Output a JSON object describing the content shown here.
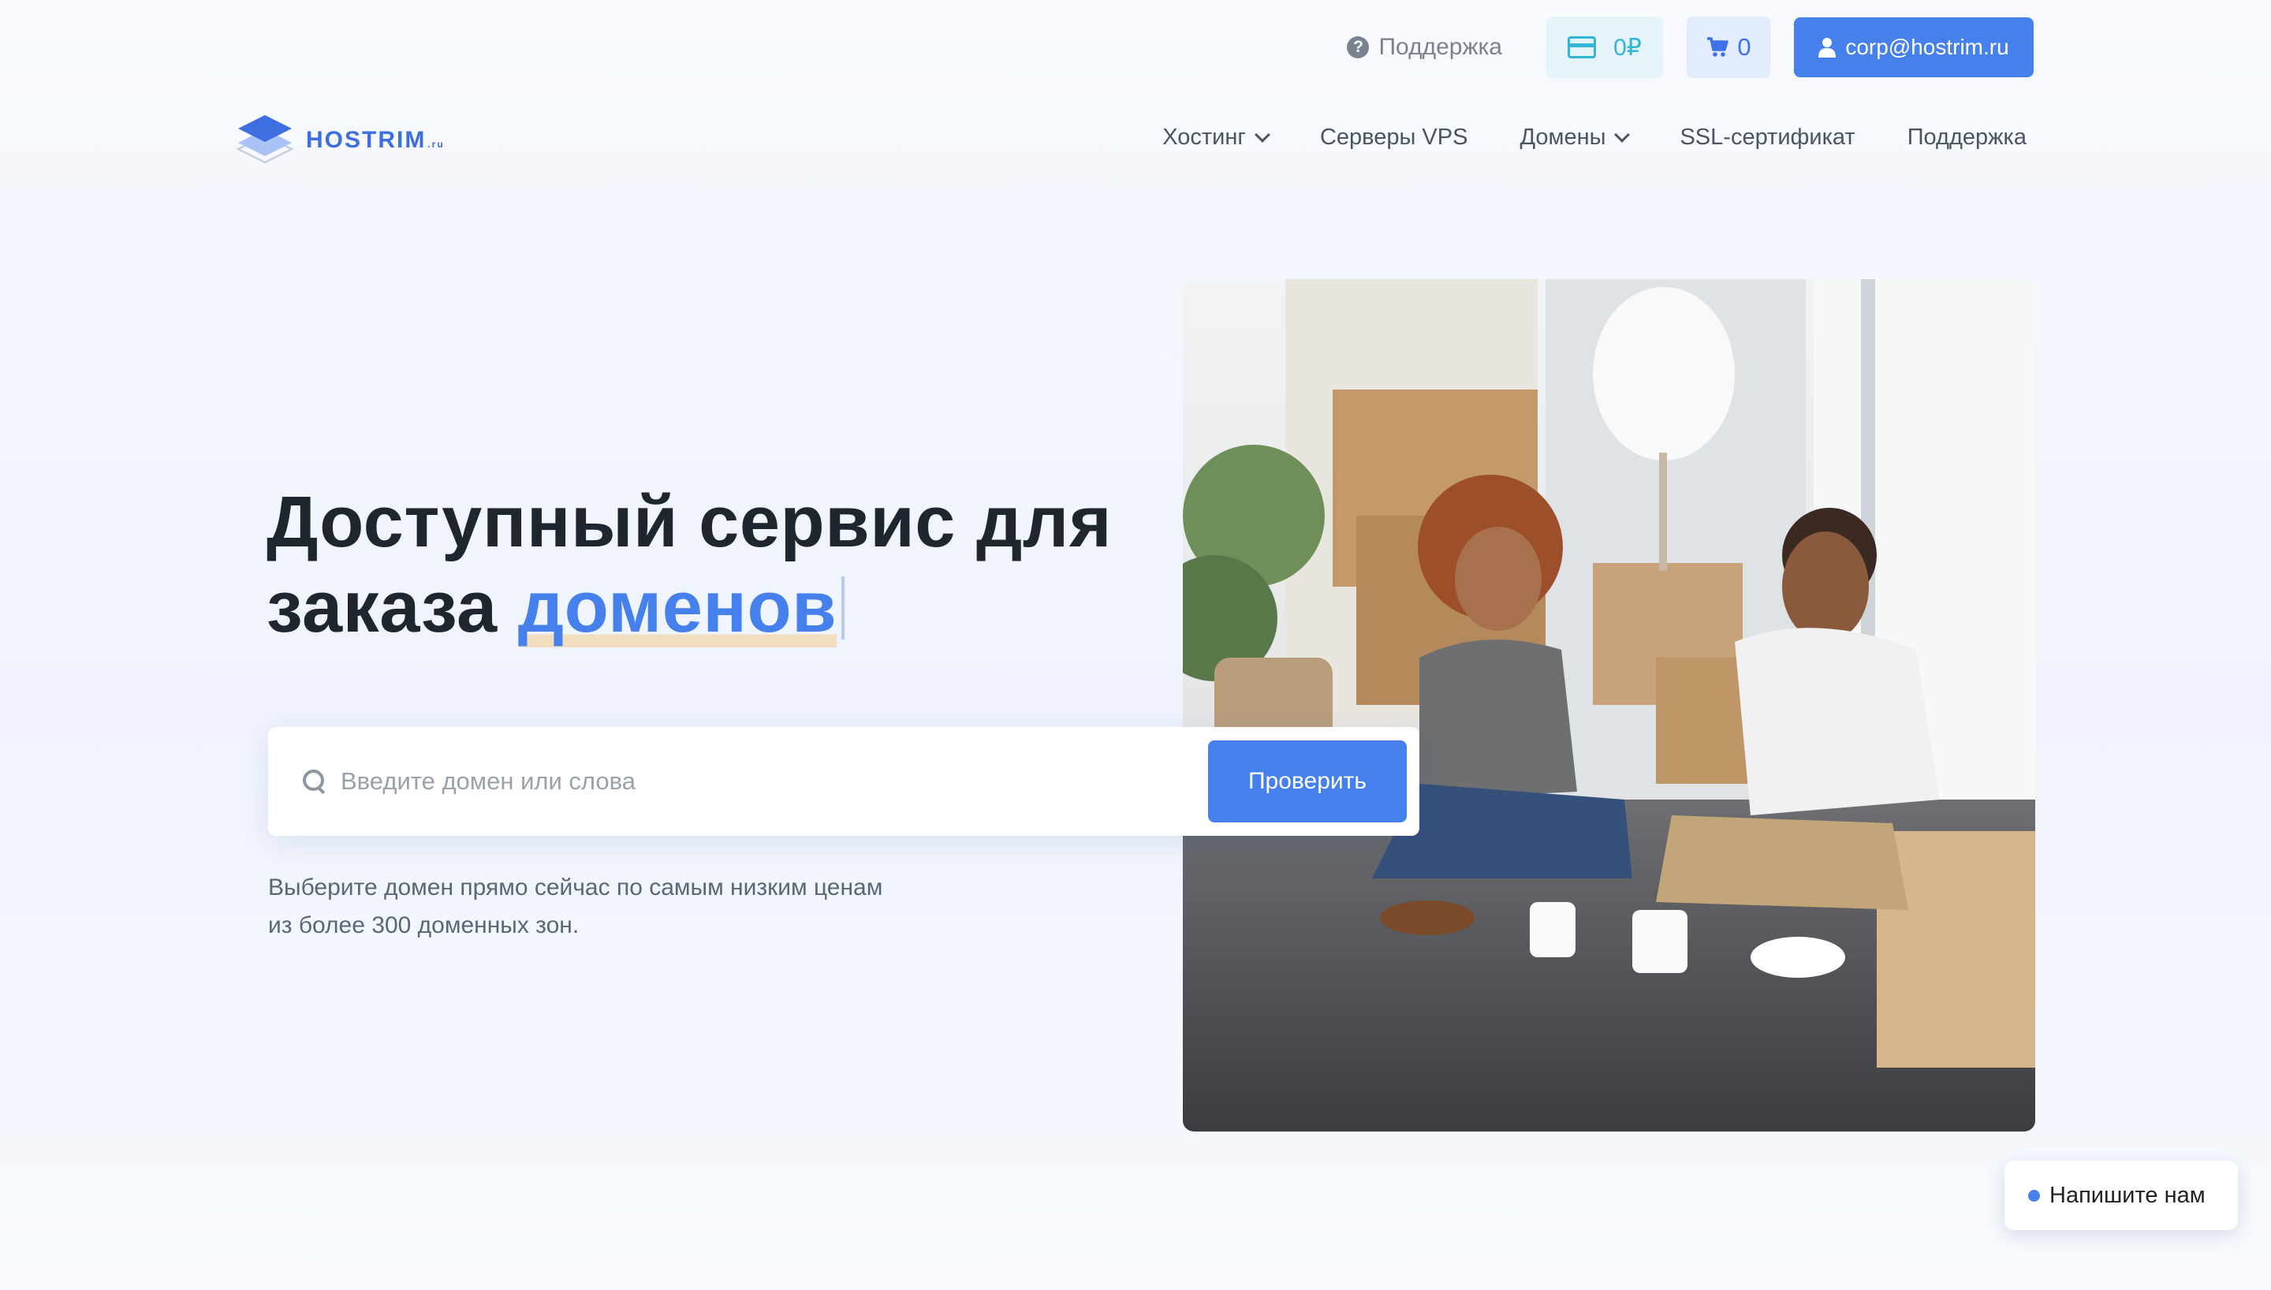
{
  "topbar": {
    "support_label": "Поддержка",
    "balance": "0₽",
    "cart_count": "0",
    "account_email": "corp@hostrim.ru"
  },
  "logo": {
    "name": "HOSTRIM",
    "tld": ".ru"
  },
  "nav": {
    "items": [
      {
        "label": "Хостинг",
        "has_dropdown": true
      },
      {
        "label": "Серверы VPS",
        "has_dropdown": false
      },
      {
        "label": "Домены",
        "has_dropdown": true
      },
      {
        "label": "SSL-сертификат",
        "has_dropdown": false
      },
      {
        "label": "Поддержка",
        "has_dropdown": false
      }
    ]
  },
  "hero": {
    "title_line1": "Доступный сервис для",
    "title_line2_plain": "заказа ",
    "title_line2_accent": "доменов",
    "search_placeholder": "Введите домен или слова",
    "check_label": "Проверить",
    "subtitle_line1": "Выберите домен прямо сейчас по самым низким ценам",
    "subtitle_line2": "из более 300 доменных зон."
  },
  "chat": {
    "label": "Напишите нам"
  },
  "colors": {
    "brand": "#4580ec",
    "balance_accent": "#31b6d7",
    "heading": "#1f262f",
    "muted_text": "#5d6673"
  },
  "icons": [
    "help-icon",
    "credit-card-icon",
    "cart-icon",
    "user-icon",
    "chevron-down-icon",
    "search-icon",
    "chat-dot-icon"
  ]
}
